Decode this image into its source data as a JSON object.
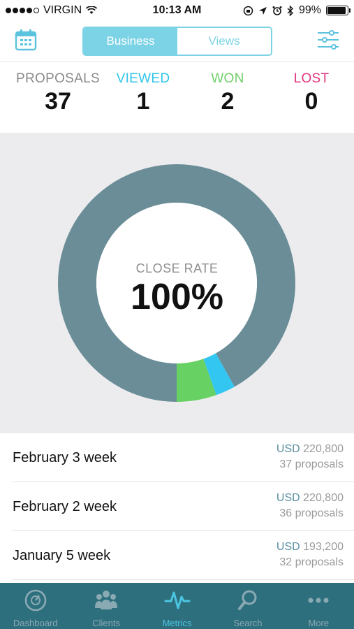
{
  "status_bar": {
    "carrier": "VIRGIN",
    "time": "10:13 AM",
    "battery": "99%"
  },
  "header": {
    "segments": [
      {
        "label": "Business",
        "active": true
      },
      {
        "label": "Views",
        "active": false
      }
    ],
    "icons": {
      "left": "calendar-icon",
      "right": "sliders-icon"
    }
  },
  "stats": {
    "proposals": {
      "label": "PROPOSALS",
      "value": "37"
    },
    "viewed": {
      "label": "VIEWED",
      "value": "1"
    },
    "won": {
      "label": "WON",
      "value": "2"
    },
    "lost": {
      "label": "LOST",
      "value": "0"
    }
  },
  "chart_data": {
    "type": "pie",
    "slices": [
      {
        "name": "PROPOSALS",
        "value": 34,
        "color": "#6a8d98"
      },
      {
        "name": "VIEWED",
        "value": 1,
        "color": "#33c6f0"
      },
      {
        "name": "WON",
        "value": 2,
        "color": "#68d163"
      }
    ],
    "center_label": "CLOSE RATE",
    "center_value": "100%"
  },
  "weeks": [
    {
      "name": "February 3 week",
      "currency": "USD",
      "amount": "220,800",
      "count": "37 proposals"
    },
    {
      "name": "February 2 week",
      "currency": "USD",
      "amount": "220,800",
      "count": "36 proposals"
    },
    {
      "name": "January 5 week",
      "currency": "USD",
      "amount": "193,200",
      "count": "32 proposals"
    }
  ],
  "tabs": [
    {
      "label": "Dashboard",
      "icon": "gauge-icon",
      "active": false
    },
    {
      "label": "Clients",
      "icon": "clients-icon",
      "active": false
    },
    {
      "label": "Metrics",
      "icon": "pulse-icon",
      "active": true
    },
    {
      "label": "Search",
      "icon": "search-icon",
      "active": false
    },
    {
      "label": "More",
      "icon": "more-dots-icon",
      "active": false
    }
  ],
  "colors": {
    "accent": "#7dd3e6",
    "viewed": "#2fc6ea",
    "won": "#6fd06a",
    "lost": "#e0357f",
    "tab_bar": "#2e6f7e"
  }
}
